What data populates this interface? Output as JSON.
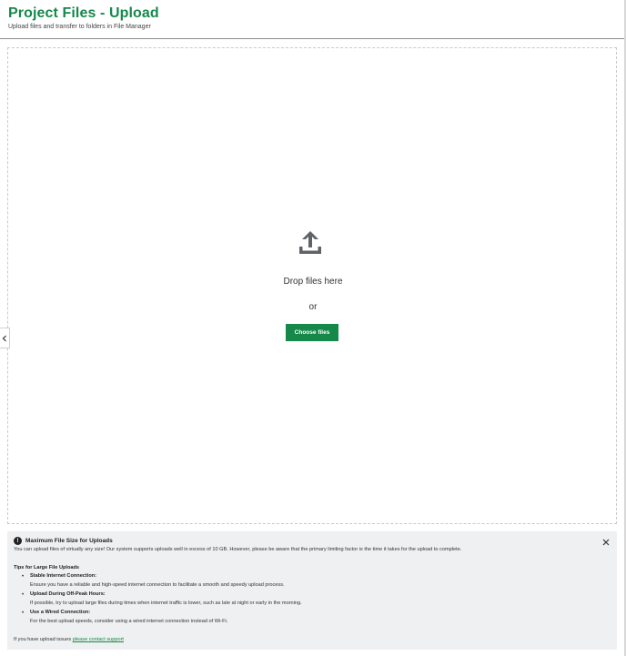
{
  "header": {
    "title": "Project Files - Upload",
    "subtitle": "Upload files and transfer to folders in File Manager"
  },
  "dropzone": {
    "icon": "upload-icon",
    "drop_text": "Drop files here",
    "or_text": "or",
    "choose_label": "Choose files"
  },
  "sidebar_toggle": {
    "icon": "chevron-left-icon"
  },
  "info": {
    "icon": "exclamation-circle-icon",
    "title": "Maximum File Size for Uploads",
    "description": "You can upload files of virtually any size! Our system supports uploads well in excess of 10 GB. However, please be aware that the primary limiting factor is the time it takes for the upload to complete.",
    "close_icon": "close-icon",
    "tips_heading": "Tips for Large File Uploads",
    "tips": [
      {
        "title": "Stable Internet Connection:",
        "desc": "Ensure you have a reliable and high-speed internet connection to facilitate a smooth and speedy upload process."
      },
      {
        "title": "Upload During Off-Peak Hours:",
        "desc": "If possible, try to upload large files during times when internet traffic is lower, such as late at night or early in the morning."
      },
      {
        "title": "Use a Wired Connection:",
        "desc": "For the best upload speeds, consider using a wired internet connection instead of Wi-Fi."
      }
    ],
    "footer_text": "If you have upload issues",
    "footer_link": "please contact support"
  },
  "colors": {
    "brand_green": "#16884a",
    "icon_gray": "#5f6368",
    "panel_bg": "#eef0f1"
  }
}
